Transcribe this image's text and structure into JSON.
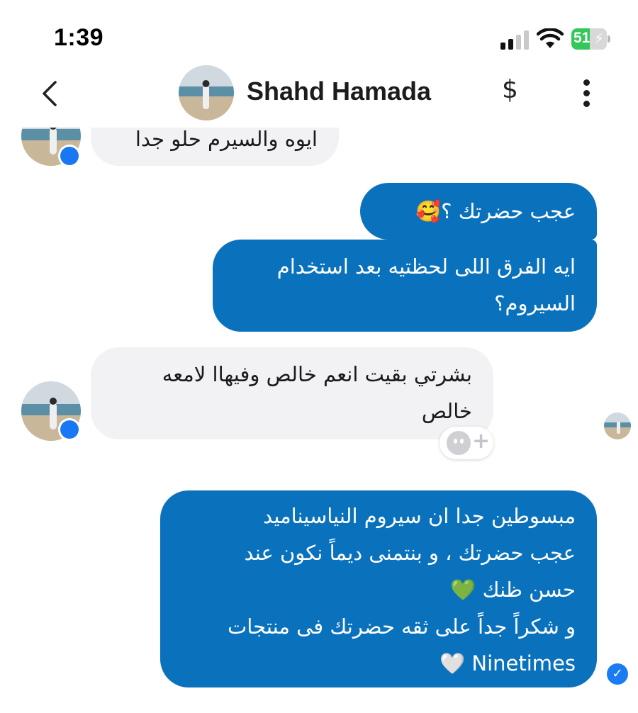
{
  "status_bar": {
    "time": "1:39",
    "battery_level": "51",
    "signal_icon": "cellular-signal-icon",
    "wifi_icon": "wifi-icon",
    "battery_icon": "battery-charging-icon"
  },
  "header": {
    "contact_name": "Shahd Hamada",
    "back_icon": "chevron-left-icon",
    "payment_icon": "dollar-icon",
    "more_icon": "more-vertical-icon"
  },
  "messages": [
    {
      "direction": "incoming",
      "lines": [
        "ايوه والسيرم حلو جدا"
      ]
    },
    {
      "direction": "outgoing",
      "lines": [
        "عجب حضرتك ؟🥰"
      ]
    },
    {
      "direction": "outgoing",
      "lines": [
        "ايه الفرق اللى لحظتيه بعد استخدام",
        "السيروم؟"
      ]
    },
    {
      "direction": "incoming",
      "lines": [
        "بشرتي بقيت انعم خالص وفيهاا لامعه",
        "خالص"
      ]
    },
    {
      "direction": "outgoing",
      "lines": [
        "مبسوطين جدا ان سيروم النياسيناميد",
        "عجب حضرتك ، و بنتمنى ديماً نكون عند",
        "حسن ظنك 💚",
        "و شكراً جداً على ثقه حضرتك فى منتجات",
        "Ninetimes 🤍"
      ]
    }
  ],
  "reaction_button": {
    "icon": "add-reaction-icon",
    "symbol": "+"
  },
  "delivered_icon": "check-circle-icon",
  "colors": {
    "outgoing_bubble": "#0a72bd",
    "incoming_bubble": "#f2f2f4",
    "messenger_badge": "#1877f2",
    "battery": "#34c759"
  }
}
